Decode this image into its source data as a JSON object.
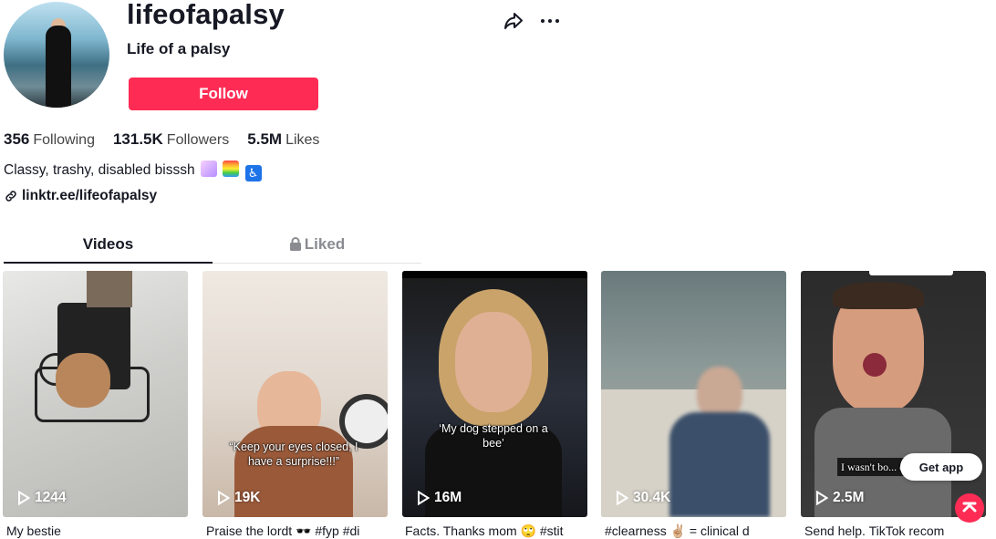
{
  "profile": {
    "username": "lifeofapalsy",
    "display_name": "Life of a palsy",
    "follow_label": "Follow",
    "stats": [
      {
        "value": "356",
        "label": "Following"
      },
      {
        "value": "131.5K",
        "label": "Followers"
      },
      {
        "value": "5.5M",
        "label": "Likes"
      }
    ],
    "bio": "Classy, trashy, disabled bisssh",
    "bio_emojis": [
      "unicorn-emoji",
      "rainbow-emoji",
      "wheelchair-emoji"
    ],
    "link": "linktr.ee/lifeofapalsy"
  },
  "tabs": {
    "videos": "Videos",
    "liked": "Liked"
  },
  "videos": [
    {
      "views": "1244",
      "desc": "My bestie",
      "overlay": ""
    },
    {
      "views": "19K",
      "desc": "Praise the lordt 🕶️ #fyp #di",
      "overlay": "“Keep your eyes closed, I have a surprise!!!”"
    },
    {
      "views": "16M",
      "desc": "Facts. Thanks mom 🙄 #stit",
      "overlay": "‘My dog stepped on a bee’"
    },
    {
      "views": "30.4K",
      "desc": "#clearness ✌🏼 = clinical d",
      "overlay": ""
    },
    {
      "views": "2.5M",
      "desc": "Send help. TikTok recom",
      "overlay": "I wasn't bo... disabil..."
    }
  ],
  "get_app_label": "Get app",
  "colors": {
    "accent": "#fe2c55",
    "text": "#161823",
    "muted": "#8a8b91"
  }
}
